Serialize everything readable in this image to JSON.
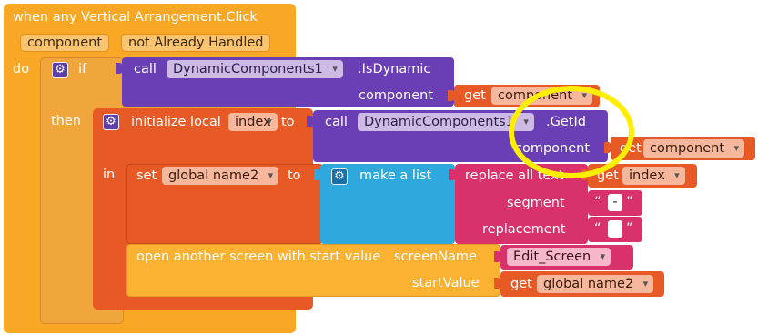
{
  "event": {
    "title": "when any Vertical Arrangement.Click",
    "param_component": "component",
    "param_not_handled": "not Already Handled",
    "do_label": "do"
  },
  "if_block": {
    "if_label": "if",
    "then_label": "then",
    "call1": {
      "call_label": "call",
      "component_name": "DynamicComponents1",
      "method": ".IsDynamic",
      "arg_label": "component",
      "get_label": "get",
      "get_value": "component"
    }
  },
  "local": {
    "init_label": "initialize local",
    "var_name": "index",
    "to_label": "to",
    "in_label": "in",
    "call2": {
      "call_label": "call",
      "component_name": "DynamicComponents1",
      "method": ".GetId",
      "arg_label": "component",
      "get_label": "get",
      "get_value": "component"
    }
  },
  "set_block": {
    "set_label": "set",
    "var_name": "global name2",
    "to_label": "to",
    "make_list_label": "make a list",
    "replace_label": "replace all text",
    "get_label": "get",
    "get_value": "index",
    "segment_label": "segment",
    "segment_value": "-",
    "replacement_label": "replacement",
    "replacement_value": "",
    "quote_open": "“",
    "quote_close": "”"
  },
  "open_screen": {
    "label": "open another screen with start value",
    "screen_name_label": "screenName",
    "screen_value": "Edit_Screen",
    "start_value_label": "startValue",
    "get_label": "get",
    "get_value": "global name2"
  },
  "colors": {
    "event": "#f9a825",
    "control": "#f0a63a",
    "call": "#6a3fb5",
    "variable": "#e85a25",
    "list": "#2fa8de",
    "text": "#d9316b",
    "highlight": "#ffee00"
  }
}
